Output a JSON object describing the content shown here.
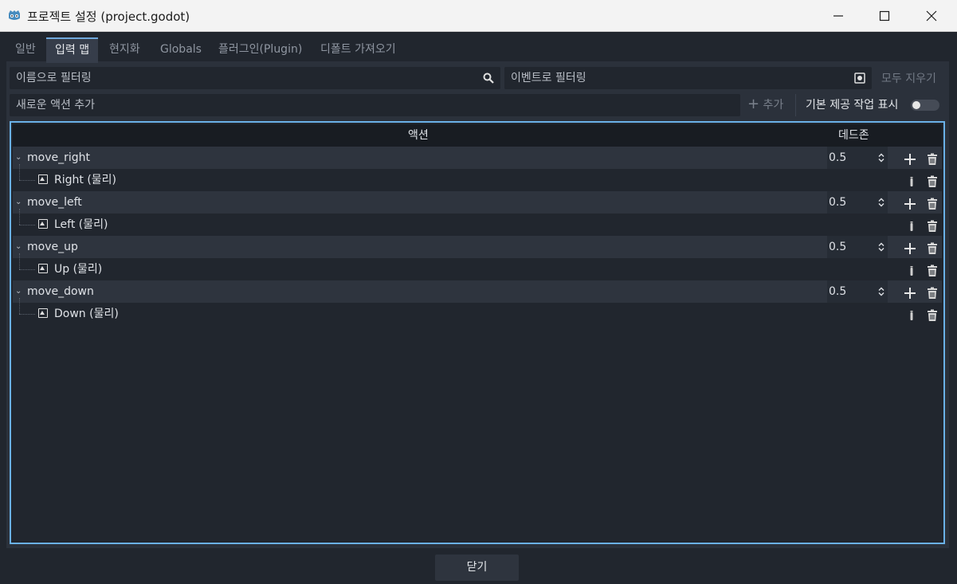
{
  "window": {
    "title": "프로젝트 설정 (project.godot)"
  },
  "tabs": [
    {
      "label": "일반"
    },
    {
      "label": "입력 맵"
    },
    {
      "label": "현지화"
    },
    {
      "label": "Globals"
    },
    {
      "label": "플러그인(Plugin)"
    },
    {
      "label": "디폴트 가져오기"
    }
  ],
  "filters": {
    "name_placeholder": "이름으로 필터링",
    "event_placeholder": "이벤트로 필터링",
    "clear_all": "모두 지우기"
  },
  "new_action": {
    "placeholder": "새로운 액션 추가",
    "add_label": "추가",
    "show_builtin_label": "기본 제공 작업 표시"
  },
  "tree": {
    "header_action": "액션",
    "header_deadzone": "데드존",
    "actions": [
      {
        "name": "move_right",
        "deadzone": "0.5",
        "event": "Right (물리)"
      },
      {
        "name": "move_left",
        "deadzone": "0.5",
        "event": "Left (물리)"
      },
      {
        "name": "move_up",
        "deadzone": "0.5",
        "event": "Up (물리)"
      },
      {
        "name": "move_down",
        "deadzone": "0.5",
        "event": "Down (물리)"
      }
    ]
  },
  "footer": {
    "close_label": "닫기"
  },
  "colors": {
    "accent": "#6ab1e8",
    "background": "#21262e",
    "panel": "#2b313b"
  }
}
